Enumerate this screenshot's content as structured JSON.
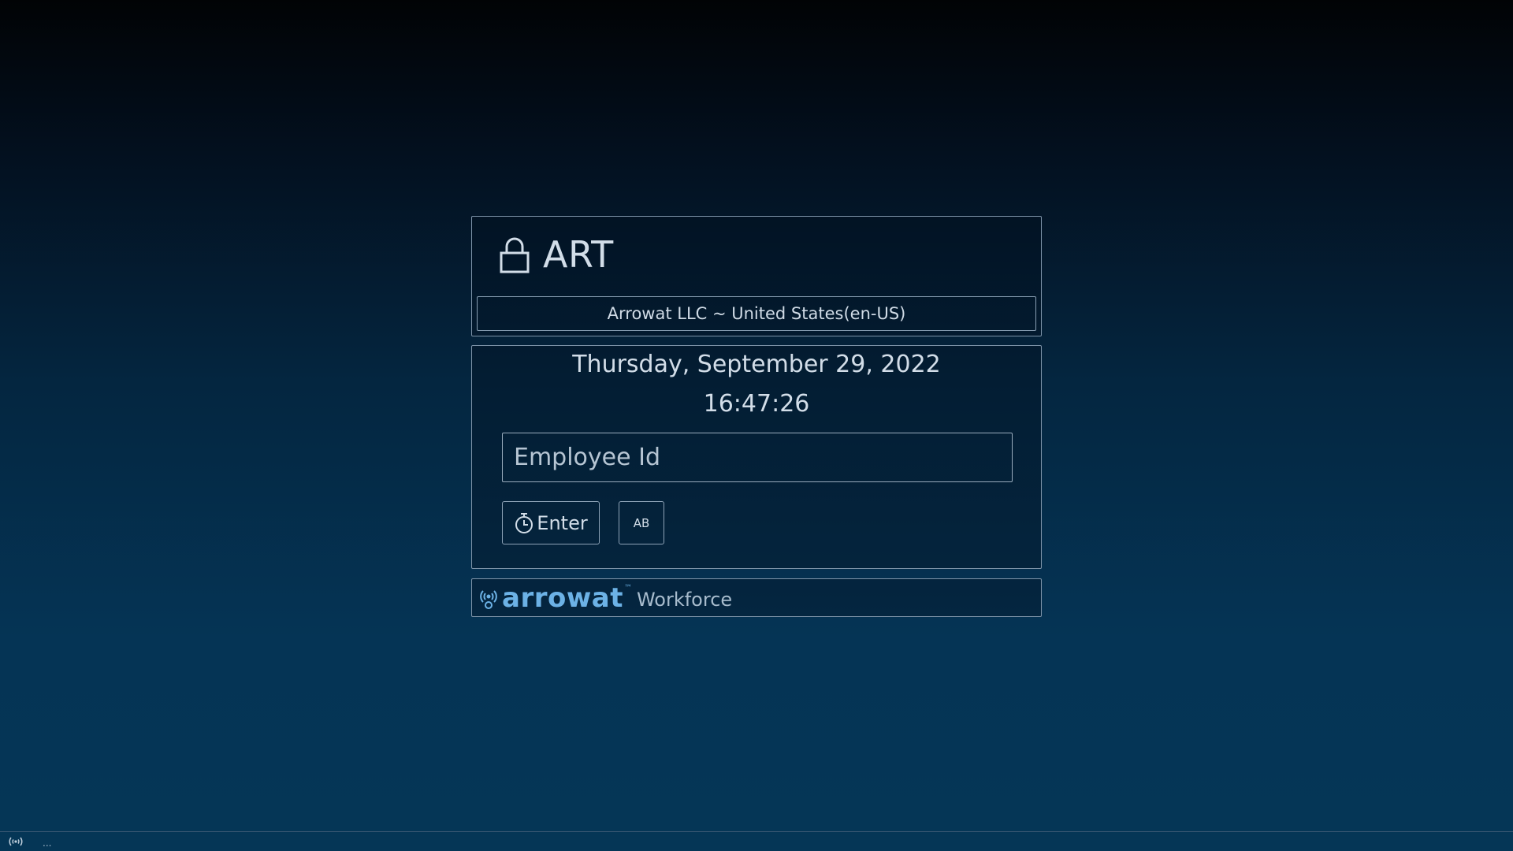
{
  "header": {
    "title": "ART",
    "lock_icon": "lock-icon",
    "company_locale": "Arrowat LLC ~ United States(en-US)"
  },
  "clock": {
    "date": "Thursday, September 29, 2022",
    "time": "16:47:26",
    "employee_input": {
      "value": "",
      "placeholder": "Employee Id"
    },
    "enter_button": {
      "label": "Enter",
      "icon": "timer-icon"
    },
    "keyboard_toggle": {
      "label": "AB"
    }
  },
  "footer": {
    "brand_icon": "arrowat-logo-mark",
    "brand_name": "arrowat",
    "brand_tm": "™",
    "product": "Workforce"
  },
  "status_bar": {
    "signal_icon": "signal-icon",
    "text": "..."
  },
  "colors": {
    "border": "#7d93a8",
    "text": "#d2dde8",
    "brand": "#6cb2e6",
    "background_top": "#010305",
    "background_bottom": "#053656"
  }
}
